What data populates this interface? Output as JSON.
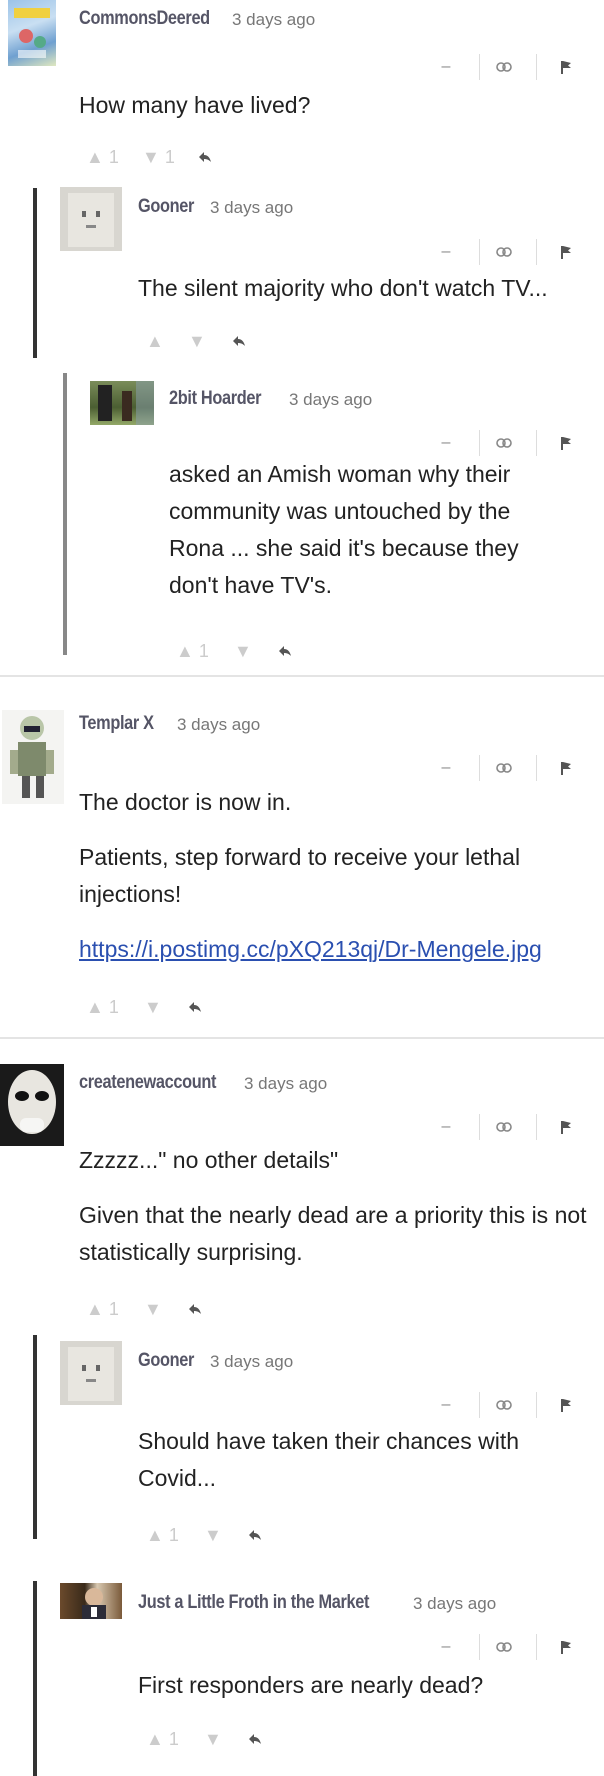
{
  "comments": [
    {
      "user": "CommonsDeered",
      "time": "3 days ago",
      "text": [
        "How many have lived?"
      ],
      "up": "▲ 1",
      "down": "▼ 1"
    },
    {
      "user": "Gooner",
      "time": "3 days ago",
      "text": [
        "The silent majority who don't watch TV..."
      ],
      "up": "▲",
      "down": "▼"
    },
    {
      "user": "2bit Hoarder",
      "time": "3 days ago",
      "text": [
        "asked an Amish woman why their community was untouched by the Rona ... she said it's because they don't have TV's."
      ],
      "up": "▲ 1",
      "down": "▼"
    },
    {
      "user": "Templar X",
      "time": "3 days ago",
      "text": [
        "The doctor is now in.",
        "Patients, step forward to receive your lethal injections!"
      ],
      "link": "https://i.postimg.cc/pXQ213qj/Dr-Mengele.jpg",
      "up": "▲ 1",
      "down": "▼"
    },
    {
      "user": "createnewaccount",
      "time": "3 days ago",
      "text": [
        "Zzzzz...\" no other details\"",
        "Given that the nearly dead are a priority this is not statistically surprising."
      ],
      "up": "▲ 1",
      "down": "▼"
    },
    {
      "user": "Gooner",
      "time": "3 days ago",
      "text": [
        "Should have taken their chances with Covid..."
      ],
      "up": "▲ 1",
      "down": "▼"
    },
    {
      "user": "Just a Little Froth in the Market",
      "time": "3 days ago",
      "text": [
        "First responders are nearly dead?"
      ],
      "up": "▲ 1",
      "down": "▼"
    }
  ],
  "controls": {
    "collapse": "–",
    "link_icon": "link-icon",
    "flag_icon": "flag-icon"
  },
  "reply_icon": "reply-icon"
}
